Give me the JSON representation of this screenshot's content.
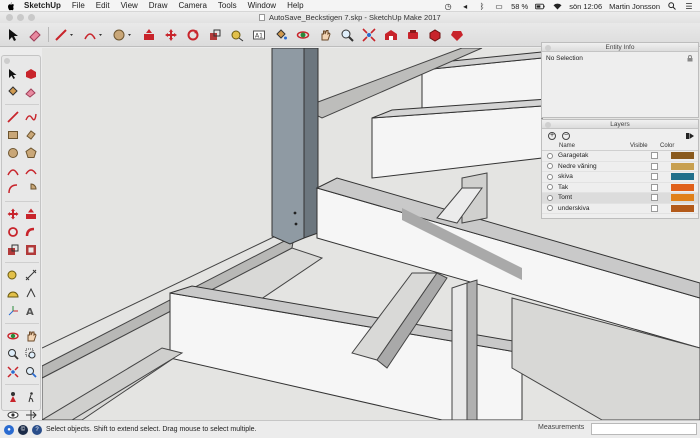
{
  "menubar": {
    "app_name": "SketchUp",
    "items": [
      "File",
      "Edit",
      "View",
      "Draw",
      "Camera",
      "Tools",
      "Window",
      "Help"
    ],
    "battery": "58 %",
    "clock": "sön 12:06",
    "user": "Martin Jonsson"
  },
  "window": {
    "title": "AutoSave_Beckstigen 7.skp - SketchUp Make 2017"
  },
  "entity_info": {
    "title": "Entity Info",
    "selection": "No Selection"
  },
  "layers": {
    "title": "Layers",
    "col_name": "Name",
    "col_visible": "Visible",
    "col_color": "Color",
    "rows": [
      {
        "name": "Garagetak",
        "color": "#8a5a1e"
      },
      {
        "name": "Nedre våning",
        "color": "#c8a050"
      },
      {
        "name": "skiva",
        "color": "#1f6f8b"
      },
      {
        "name": "Tak",
        "color": "#e0601a"
      },
      {
        "name": "Tomt",
        "color": "#e0801a"
      },
      {
        "name": "underskiva",
        "color": "#b35a1a"
      }
    ]
  },
  "status": {
    "hint": "Select objects. Shift to extend select. Drag mouse to select multiple.",
    "measurements_label": "Measurements"
  },
  "colors": {
    "accent_red": "#c8242b",
    "viewport_bg": "#e4e4e2",
    "beam_face": "#f4f4f4",
    "beam_shadow": "#a9a9a9",
    "post": "#8f9aa3"
  },
  "toolbar_icons": [
    "select-icon",
    "eraser-icon",
    "pencil-icon",
    "arc-icon",
    "shape-icon",
    "push-pull-icon",
    "move-icon",
    "rotate-icon",
    "scale-icon",
    "tape-measure-icon",
    "text-icon",
    "paint-bucket-icon",
    "orbit-icon",
    "pan-icon",
    "zoom-icon",
    "zoom-extents-icon",
    "warehouse-icon",
    "extension-icon",
    "components-icon",
    "ruby-icon"
  ]
}
